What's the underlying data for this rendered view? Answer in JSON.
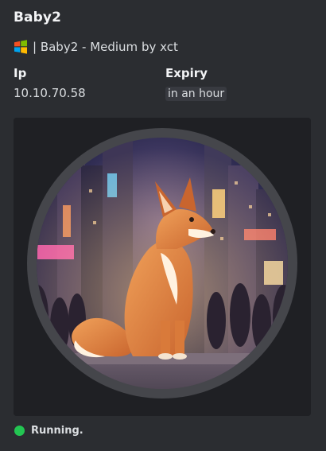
{
  "embed": {
    "title": "Baby2",
    "description": "| Baby2 - Medium by xct",
    "os_icon": "windows-icon",
    "fields": [
      {
        "name": "Ip",
        "value": "10.10.70.58"
      },
      {
        "name": "Expiry",
        "value": "in an hour"
      }
    ],
    "image_alt": "fox-in-city",
    "footer": {
      "status_text": "Running.",
      "status_color": "#23c552"
    }
  }
}
